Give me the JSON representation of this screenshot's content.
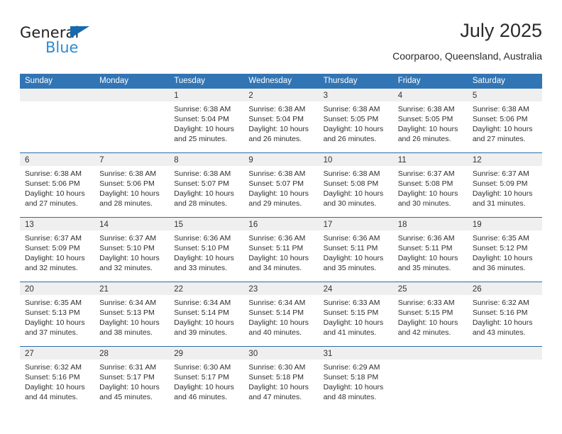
{
  "brand": {
    "name_part1": "General",
    "name_part2": "Blue",
    "flag_icon": "blue-triangle-flag-icon",
    "accent_color": "#1769b0",
    "secondary_color": "#2e8ad4"
  },
  "header": {
    "title": "July 2025",
    "location": "Coorparoo, Queensland, Australia"
  },
  "calendar": {
    "header_color": "#3275b4",
    "band_color": "#efefef",
    "weekdays": [
      "Sunday",
      "Monday",
      "Tuesday",
      "Wednesday",
      "Thursday",
      "Friday",
      "Saturday"
    ],
    "weeks": [
      [
        {
          "day": "",
          "empty": true,
          "lines": []
        },
        {
          "day": "",
          "empty": true,
          "lines": []
        },
        {
          "day": "1",
          "empty": false,
          "lines": [
            "Sunrise: 6:38 AM",
            "Sunset: 5:04 PM",
            "Daylight: 10 hours",
            "and 25 minutes."
          ]
        },
        {
          "day": "2",
          "empty": false,
          "lines": [
            "Sunrise: 6:38 AM",
            "Sunset: 5:04 PM",
            "Daylight: 10 hours",
            "and 26 minutes."
          ]
        },
        {
          "day": "3",
          "empty": false,
          "lines": [
            "Sunrise: 6:38 AM",
            "Sunset: 5:05 PM",
            "Daylight: 10 hours",
            "and 26 minutes."
          ]
        },
        {
          "day": "4",
          "empty": false,
          "lines": [
            "Sunrise: 6:38 AM",
            "Sunset: 5:05 PM",
            "Daylight: 10 hours",
            "and 26 minutes."
          ]
        },
        {
          "day": "5",
          "empty": false,
          "lines": [
            "Sunrise: 6:38 AM",
            "Sunset: 5:06 PM",
            "Daylight: 10 hours",
            "and 27 minutes."
          ]
        }
      ],
      [
        {
          "day": "6",
          "empty": false,
          "lines": [
            "Sunrise: 6:38 AM",
            "Sunset: 5:06 PM",
            "Daylight: 10 hours",
            "and 27 minutes."
          ]
        },
        {
          "day": "7",
          "empty": false,
          "lines": [
            "Sunrise: 6:38 AM",
            "Sunset: 5:06 PM",
            "Daylight: 10 hours",
            "and 28 minutes."
          ]
        },
        {
          "day": "8",
          "empty": false,
          "lines": [
            "Sunrise: 6:38 AM",
            "Sunset: 5:07 PM",
            "Daylight: 10 hours",
            "and 28 minutes."
          ]
        },
        {
          "day": "9",
          "empty": false,
          "lines": [
            "Sunrise: 6:38 AM",
            "Sunset: 5:07 PM",
            "Daylight: 10 hours",
            "and 29 minutes."
          ]
        },
        {
          "day": "10",
          "empty": false,
          "lines": [
            "Sunrise: 6:38 AM",
            "Sunset: 5:08 PM",
            "Daylight: 10 hours",
            "and 30 minutes."
          ]
        },
        {
          "day": "11",
          "empty": false,
          "lines": [
            "Sunrise: 6:37 AM",
            "Sunset: 5:08 PM",
            "Daylight: 10 hours",
            "and 30 minutes."
          ]
        },
        {
          "day": "12",
          "empty": false,
          "lines": [
            "Sunrise: 6:37 AM",
            "Sunset: 5:09 PM",
            "Daylight: 10 hours",
            "and 31 minutes."
          ]
        }
      ],
      [
        {
          "day": "13",
          "empty": false,
          "lines": [
            "Sunrise: 6:37 AM",
            "Sunset: 5:09 PM",
            "Daylight: 10 hours",
            "and 32 minutes."
          ]
        },
        {
          "day": "14",
          "empty": false,
          "lines": [
            "Sunrise: 6:37 AM",
            "Sunset: 5:10 PM",
            "Daylight: 10 hours",
            "and 32 minutes."
          ]
        },
        {
          "day": "15",
          "empty": false,
          "lines": [
            "Sunrise: 6:36 AM",
            "Sunset: 5:10 PM",
            "Daylight: 10 hours",
            "and 33 minutes."
          ]
        },
        {
          "day": "16",
          "empty": false,
          "lines": [
            "Sunrise: 6:36 AM",
            "Sunset: 5:11 PM",
            "Daylight: 10 hours",
            "and 34 minutes."
          ]
        },
        {
          "day": "17",
          "empty": false,
          "lines": [
            "Sunrise: 6:36 AM",
            "Sunset: 5:11 PM",
            "Daylight: 10 hours",
            "and 35 minutes."
          ]
        },
        {
          "day": "18",
          "empty": false,
          "lines": [
            "Sunrise: 6:36 AM",
            "Sunset: 5:11 PM",
            "Daylight: 10 hours",
            "and 35 minutes."
          ]
        },
        {
          "day": "19",
          "empty": false,
          "lines": [
            "Sunrise: 6:35 AM",
            "Sunset: 5:12 PM",
            "Daylight: 10 hours",
            "and 36 minutes."
          ]
        }
      ],
      [
        {
          "day": "20",
          "empty": false,
          "lines": [
            "Sunrise: 6:35 AM",
            "Sunset: 5:13 PM",
            "Daylight: 10 hours",
            "and 37 minutes."
          ]
        },
        {
          "day": "21",
          "empty": false,
          "lines": [
            "Sunrise: 6:34 AM",
            "Sunset: 5:13 PM",
            "Daylight: 10 hours",
            "and 38 minutes."
          ]
        },
        {
          "day": "22",
          "empty": false,
          "lines": [
            "Sunrise: 6:34 AM",
            "Sunset: 5:14 PM",
            "Daylight: 10 hours",
            "and 39 minutes."
          ]
        },
        {
          "day": "23",
          "empty": false,
          "lines": [
            "Sunrise: 6:34 AM",
            "Sunset: 5:14 PM",
            "Daylight: 10 hours",
            "and 40 minutes."
          ]
        },
        {
          "day": "24",
          "empty": false,
          "lines": [
            "Sunrise: 6:33 AM",
            "Sunset: 5:15 PM",
            "Daylight: 10 hours",
            "and 41 minutes."
          ]
        },
        {
          "day": "25",
          "empty": false,
          "lines": [
            "Sunrise: 6:33 AM",
            "Sunset: 5:15 PM",
            "Daylight: 10 hours",
            "and 42 minutes."
          ]
        },
        {
          "day": "26",
          "empty": false,
          "lines": [
            "Sunrise: 6:32 AM",
            "Sunset: 5:16 PM",
            "Daylight: 10 hours",
            "and 43 minutes."
          ]
        }
      ],
      [
        {
          "day": "27",
          "empty": false,
          "lines": [
            "Sunrise: 6:32 AM",
            "Sunset: 5:16 PM",
            "Daylight: 10 hours",
            "and 44 minutes."
          ]
        },
        {
          "day": "28",
          "empty": false,
          "lines": [
            "Sunrise: 6:31 AM",
            "Sunset: 5:17 PM",
            "Daylight: 10 hours",
            "and 45 minutes."
          ]
        },
        {
          "day": "29",
          "empty": false,
          "lines": [
            "Sunrise: 6:30 AM",
            "Sunset: 5:17 PM",
            "Daylight: 10 hours",
            "and 46 minutes."
          ]
        },
        {
          "day": "30",
          "empty": false,
          "lines": [
            "Sunrise: 6:30 AM",
            "Sunset: 5:18 PM",
            "Daylight: 10 hours",
            "and 47 minutes."
          ]
        },
        {
          "day": "31",
          "empty": false,
          "lines": [
            "Sunrise: 6:29 AM",
            "Sunset: 5:18 PM",
            "Daylight: 10 hours",
            "and 48 minutes."
          ]
        },
        {
          "day": "",
          "empty": true,
          "lines": []
        },
        {
          "day": "",
          "empty": true,
          "lines": []
        }
      ]
    ]
  }
}
